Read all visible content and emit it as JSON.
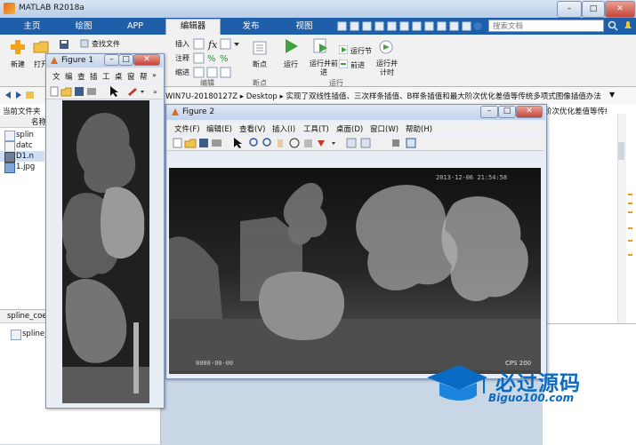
{
  "window": {
    "title": "MATLAB R2018a"
  },
  "tabs": [
    {
      "label": "主页"
    },
    {
      "label": "绘图"
    },
    {
      "label": "APP"
    },
    {
      "label": "编辑器"
    },
    {
      "label": "发布"
    },
    {
      "label": "视图"
    }
  ],
  "search": {
    "placeholder": "搜索文档"
  },
  "ribbon": {
    "new": "新建",
    "open": "打开",
    "find_file": "查找文件",
    "insert": "插入",
    "comment": "注释",
    "indent": "缩进",
    "breakpoint": "断点",
    "run": "运行",
    "run_advance": "运行并前进",
    "run_section": "运行节",
    "advance": "前进",
    "run_time": "运行并计时",
    "group_edit": "编辑",
    "group_breakpoint": "断点",
    "group_run": "运行"
  },
  "address": {
    "path": "WIN7U-20180127Z ▸ Desktop ▸ 实现了双线性插值、三次样条插值、B样条插值和最大阶次优化差值等传统多项式图像插值办法"
  },
  "filepanel": {
    "header": "当前文件夹",
    "name_col": "名称",
    "files": [
      "splin",
      "datc",
      "D1.n",
      "1.jpg"
    ],
    "details_title": "spline_coe",
    "details_item": "spline_"
  },
  "figure1": {
    "title": "Figure 1",
    "menu": [
      "文",
      "编",
      "查",
      "插",
      "工",
      "桌",
      "窗",
      "帮"
    ]
  },
  "figure2": {
    "title": "Figure 2",
    "menu": [
      "文件(F)",
      "编辑(E)",
      "查看(V)",
      "插入(I)",
      "工具(T)",
      "桌面(D)",
      "窗口(W)",
      "帮助(H)"
    ],
    "timestamp": "2013-12-06  21:54:58",
    "stamp_left": "0000-00-00",
    "stamp_right": "CPS 200"
  },
  "right_path_suffix": "阶次优化差值等传统多项式图像插值办法",
  "watermark": {
    "text": "必过源码",
    "url": "Biguo100.com"
  },
  "colors": {
    "tabbar": "#1f5ea8",
    "ribbon": "#f1f1f1",
    "watermark": "#0a6bc4"
  }
}
